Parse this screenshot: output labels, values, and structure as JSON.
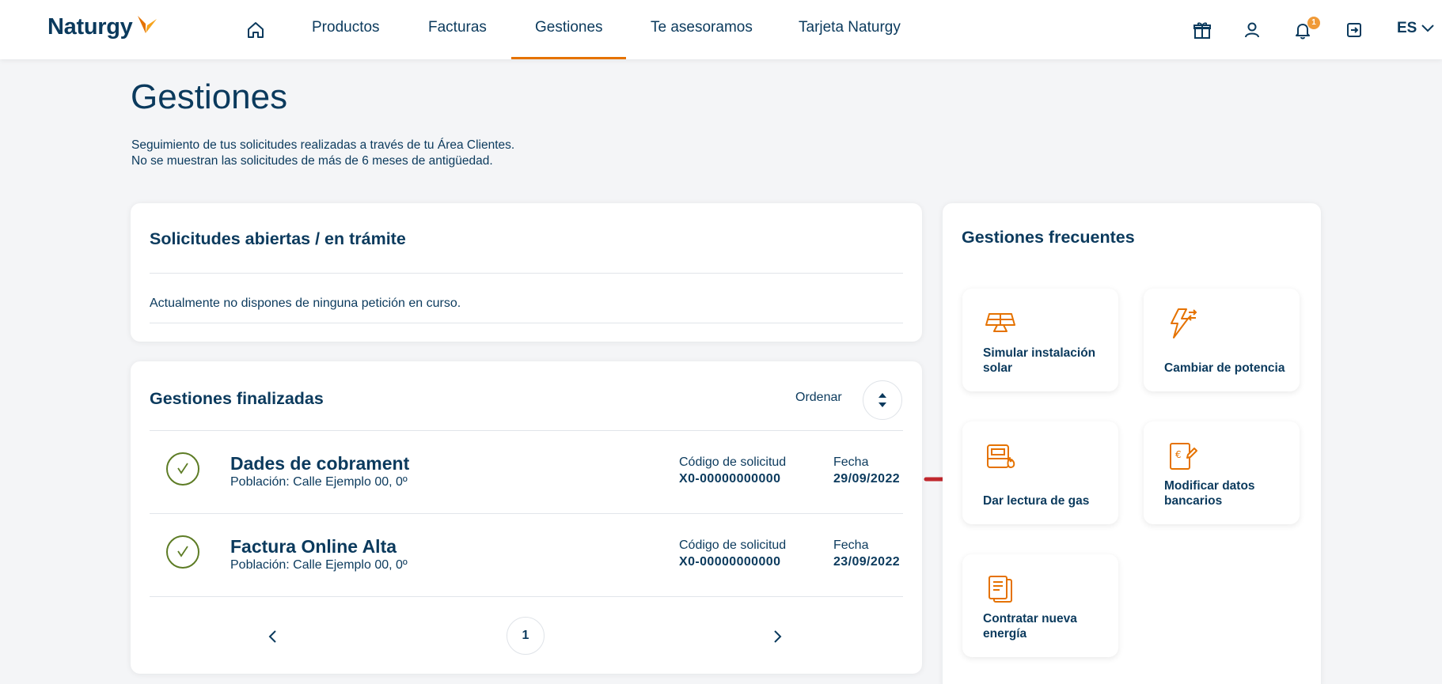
{
  "colors": {
    "navy": "#0b3a5d",
    "orange": "#e57200",
    "accent_red": "#c0272d",
    "check_green": "#5d7c25"
  },
  "header": {
    "logo": "Naturgy",
    "nav": [
      "Productos",
      "Facturas",
      "Gestiones",
      "Te asesoramos",
      "Tarjeta Naturgy"
    ],
    "active_nav": "Gestiones",
    "notification_count": "1",
    "language": "ES",
    "icons": [
      "home-icon",
      "gift-icon",
      "user-icon",
      "bell-icon",
      "logout-icon",
      "chevron-down-icon"
    ]
  },
  "page": {
    "title": "Gestiones",
    "subtitle_line1": "Seguimiento de tus solicitudes realizadas a través de tu Área Clientes.",
    "subtitle_line2": "No se muestran las solicitudes de más de 6 meses de antigüedad."
  },
  "open_requests": {
    "title": "Solicitudes abiertas / en trámite",
    "empty_text": "Actualmente no dispones de ninguna petición en curso."
  },
  "finished": {
    "title": "Gestiones finalizadas",
    "sort_label": "Ordenar",
    "rows": [
      {
        "title": "Dades de cobrament",
        "subtitle": "Población: Calle Ejemplo 00, 0º",
        "code_label": "Código de solicitud",
        "code": "X0-00000000000",
        "date_label": "Fecha",
        "date": "29/09/2022"
      },
      {
        "title": "Factura Online Alta",
        "subtitle": "Población: Calle Ejemplo 00, 0º",
        "code_label": "Código de solicitud",
        "code": "X0-00000000000",
        "date_label": "Fecha",
        "date": "23/09/2022"
      }
    ],
    "page": "1"
  },
  "frequent": {
    "title": "Gestiones frecuentes",
    "tiles": [
      {
        "label": "Simular instalación solar",
        "icon": "solar-panel-icon"
      },
      {
        "label": "Cambiar de potencia",
        "icon": "lightning-swap-icon"
      },
      {
        "label": "Dar lectura de gas",
        "icon": "gas-meter-icon"
      },
      {
        "label": "Modificar datos bancarios",
        "icon": "euro-document-icon"
      },
      {
        "label": "Contratar nueva energía",
        "icon": "documents-icon"
      }
    ]
  }
}
